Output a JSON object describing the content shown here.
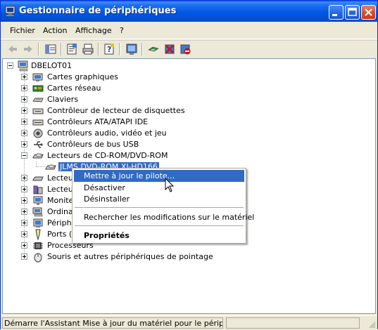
{
  "window": {
    "title": "Gestionnaire de périphériques"
  },
  "menu": [
    "Fichier",
    "Action",
    "Affichage",
    "?"
  ],
  "tree": {
    "root": "DBELOT01",
    "categories": [
      "Cartes graphiques",
      "Cartes réseau",
      "Claviers",
      "Contrôleur de lecteur de disquettes",
      "Contrôleurs ATA/ATAPI IDE",
      "Contrôleurs audio, vidéo et jeu",
      "Contrôleurs de bus USB",
      "Lecteurs de CD-ROM/DVD-ROM",
      "Lecteur",
      "Lecteur",
      "Monite",
      "Ordinat",
      "Périphé",
      "Ports (C",
      "Processeurs",
      "Souris et autres périphériques de pointage"
    ],
    "selected_device": "JLMS DVD-ROM XJ-HD166"
  },
  "context_menu": {
    "items": [
      "Mettre à jour le pilote...",
      "Désactiver",
      "Désinstaller",
      "Rechercher les modifications sur le matériel",
      "Propriétés"
    ]
  },
  "status": {
    "text": "Démarre l'Assistant Mise à jour du matériel pour le périphérique s"
  },
  "colors": {
    "titlebar": "#0058e6",
    "selection": "#316ac5",
    "chrome": "#ece9d8"
  }
}
